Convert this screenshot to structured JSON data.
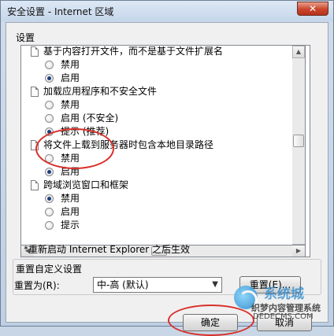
{
  "window": {
    "title": "安全设置 - Internet 区域",
    "close_glyph": "✕"
  },
  "settings": {
    "group_label": "设置",
    "sections": [
      {
        "title": "基于内容打开文件，而不是基于文件扩展名",
        "options": [
          {
            "label": "禁用",
            "checked": false
          },
          {
            "label": "启用",
            "checked": true
          }
        ]
      },
      {
        "title": "加载应用程序和不安全文件",
        "options": [
          {
            "label": "禁用",
            "checked": false
          },
          {
            "label": "启用 (不安全)",
            "checked": false
          },
          {
            "label": "提示 (推荐)",
            "checked": true
          }
        ]
      },
      {
        "title": "将文件上载到服务器时包含本地目录路径",
        "options": [
          {
            "label": "禁用",
            "checked": false
          },
          {
            "label": "启用",
            "checked": true
          }
        ]
      },
      {
        "title": "跨域浏览窗口和框架",
        "options": [
          {
            "label": "禁用",
            "checked": true
          },
          {
            "label": "启用",
            "checked": false
          },
          {
            "label": "提示",
            "checked": false
          }
        ]
      }
    ]
  },
  "restart_note": "*重新启动 Internet Explorer 之后生效",
  "reset": {
    "group_title": "重置自定义设置",
    "reset_to_label": "重置为(R):",
    "selected_level": "中-高 (默认)",
    "reset_button": "重置(E)...",
    "arrow_glyph": "▼"
  },
  "buttons": {
    "ok": "确定",
    "cancel": "取消"
  },
  "watermark": {
    "brand": "系统城",
    "cn_text": "织梦内容管理系统",
    "domain": "DEDECMS.COM"
  },
  "colors": {
    "annotation_red": "#d8302a",
    "title_bar": "#c5d6ea"
  }
}
